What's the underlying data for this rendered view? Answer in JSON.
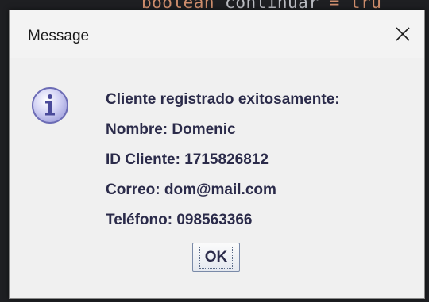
{
  "background": {
    "code_keyword": "boolean",
    "code_ident": "continuar",
    "code_value": "tru"
  },
  "dialog": {
    "title": "Message",
    "close_icon": "close-icon",
    "info_icon": "information-icon",
    "message_lines": [
      "Cliente registrado exitosamente:",
      "Nombre: Domenic",
      "ID Cliente: 1715826812",
      "Correo: dom@mail.com",
      "Teléfono: 098563366"
    ],
    "ok_label": "OK"
  },
  "colors": {
    "dialog_bg": "#f0f0f0",
    "text": "#2b2b4a",
    "icon_fill": "#c9c9ef",
    "icon_border": "#6c6cb5"
  }
}
